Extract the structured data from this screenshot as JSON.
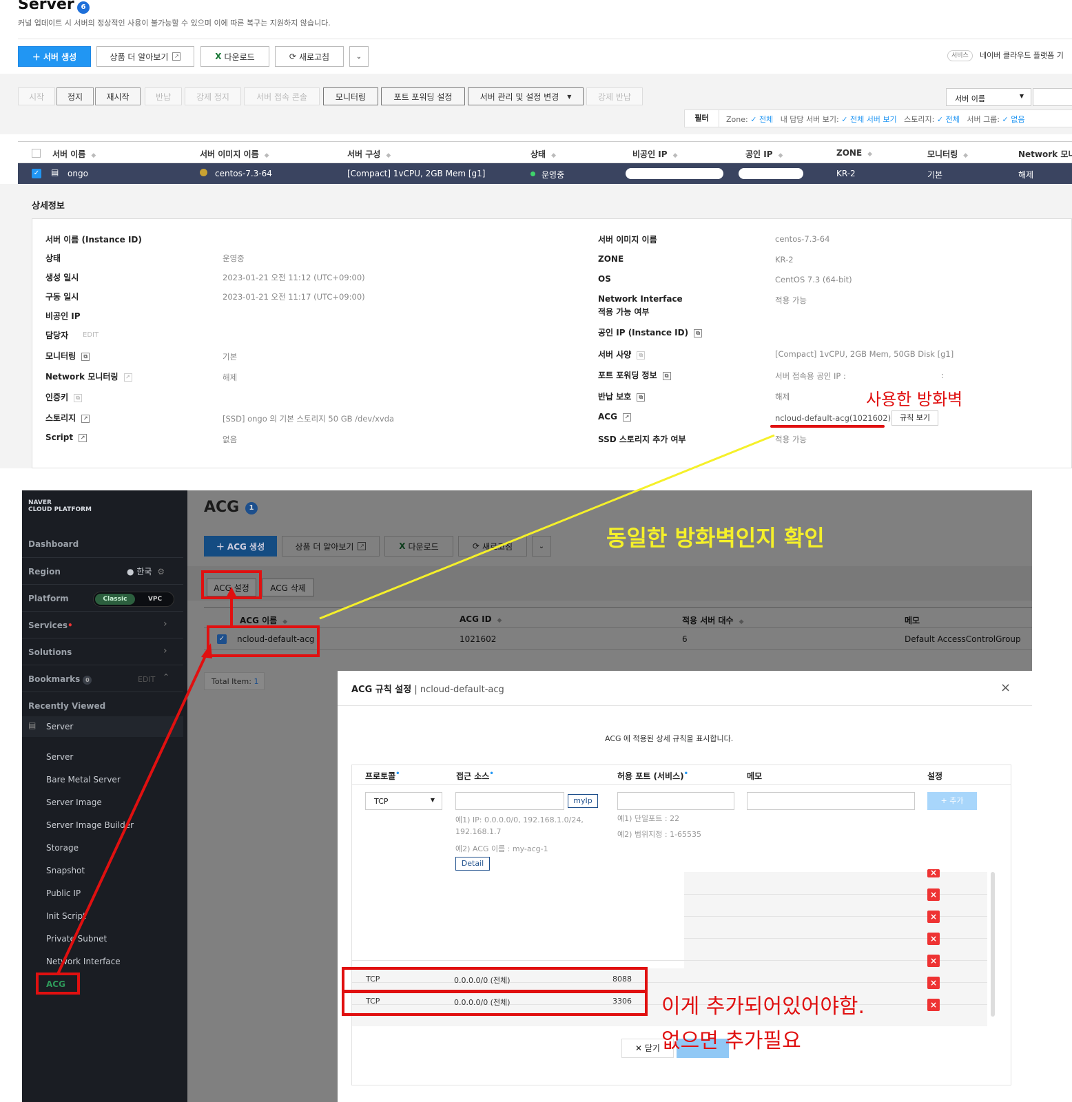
{
  "top": {
    "title": "Server",
    "title_badge": "6",
    "notice": "커널 업데이트 시 서버의 정상적인 사용이 불가능할 수 있으며 이에 따른 복구는 지원하지 않습니다.",
    "toolbar": {
      "create": "서버 생성",
      "learn_more": "상품 더 알아보기",
      "download": "다운로드",
      "refresh": "새로고침"
    },
    "service_tag": "서비스",
    "service_text": "네이버 클라우드 플랫폼 기",
    "actions": [
      "시작",
      "정지",
      "재시작",
      "반납",
      "강제 정지",
      "서버 접속 콘솔",
      "모니터링",
      "포트 포워딩 설정",
      "서버 관리 및 설정 변경",
      "강제 반납"
    ],
    "search_select": "서버 이름",
    "filter": {
      "label": "필터",
      "zone_label": "Zone:",
      "zone_val": "전체",
      "mine_label": "내 담당 서버 보기:",
      "mine_val": "전체 서버 보기",
      "storage_label": "스토리지:",
      "storage_val": "전체",
      "group_label": "서버 그룹:",
      "group_val": "없음"
    },
    "table": {
      "headers": [
        "서버 이름",
        "서버 이미지 이름",
        "서버 구성",
        "상태",
        "비공인 IP",
        "공인 IP",
        "ZONE",
        "모니터링",
        "Network 모니터"
      ],
      "row": {
        "name": "ongo",
        "image": "centos-7.3-64",
        "spec": "[Compact] 1vCPU, 2GB Mem [g1]",
        "status": "운영중",
        "zone": "KR-2",
        "monitoring": "기본",
        "network": "해제"
      }
    },
    "detail": {
      "title": "상세정보",
      "left": [
        {
          "label": "서버 이름 (Instance ID)",
          "value": ""
        },
        {
          "label": "상태",
          "value": "운영중"
        },
        {
          "label": "생성 일시",
          "value": "2023-01-21 오전 11:12 (UTC+09:00)"
        },
        {
          "label": "구동 일시",
          "value": "2023-01-21 오전 11:17 (UTC+09:00)"
        },
        {
          "label": "비공인 IP",
          "value": ""
        },
        {
          "label": "담당자",
          "value": ""
        },
        {
          "label": "모니터링",
          "value": "기본"
        },
        {
          "label": "Network 모니터링",
          "value": "해제"
        },
        {
          "label": "인증키",
          "value": ""
        },
        {
          "label": "스토리지",
          "value": "[SSD] ongo 의 기본 스토리지  50 GB /dev/xvda"
        },
        {
          "label": "Script",
          "value": "없음"
        }
      ],
      "edit": "EDIT",
      "right": [
        {
          "label": "서버 이미지 이름",
          "value": "centos-7.3-64"
        },
        {
          "label": "ZONE",
          "value": "KR-2"
        },
        {
          "label": "OS",
          "value": "CentOS 7.3 (64-bit)"
        },
        {
          "label": "Network Interface",
          "label2": "적용 가능 여부",
          "value": "적용 가능"
        },
        {
          "label": "공인 IP (Instance ID)",
          "value": ""
        },
        {
          "label": "서버 사양",
          "value": "[Compact] 1vCPU, 2GB Mem, 50GB Disk [g1]"
        },
        {
          "label": "포트 포워딩 정보",
          "value": "서버 접속용 공인 IP :"
        },
        {
          "label": "반납 보호",
          "value": "해제"
        },
        {
          "label": "ACG",
          "value": "ncloud-default-acg(1021602)"
        },
        {
          "label": "SSD 스토리지 추가 여부",
          "value": "적용 가능"
        }
      ],
      "rule_view": "규칙 보기",
      "colon": ":"
    }
  },
  "annotations": {
    "firewall_used": "사용한 방화벽",
    "same_firewall": "동일한 방화벽인지 확인",
    "must_be_added": "이게 추가되어있어야함.",
    "add_if_missing": "없으면 추가필요"
  },
  "sidebar": {
    "brand1": "NAVER",
    "brand2": "CLOUD PLATFORM",
    "dashboard": "Dashboard",
    "region": "Region",
    "region_val": "한국",
    "platform": "Platform",
    "classic": "Classic",
    "vpc": "VPC",
    "services": "Services",
    "solutions": "Solutions",
    "bookmarks": "Bookmarks",
    "bookmarks_count": "0",
    "edit": "EDIT",
    "recent": "Recently Viewed",
    "server": "Server",
    "items": [
      "Server",
      "Bare Metal Server",
      "Server Image",
      "Server Image Builder",
      "Storage",
      "Snapshot",
      "Public IP",
      "Init Script",
      "Private Subnet",
      "Network Interface",
      "ACG"
    ]
  },
  "acg": {
    "title": "ACG",
    "badge": "1",
    "create": "ACG 생성",
    "learn_more": "상품 더 알아보기",
    "download": "다운로드",
    "refresh": "새로고침",
    "setting": "ACG 설정",
    "delete": "ACG 삭제",
    "headers": [
      "ACG 이름",
      "ACG ID",
      "적용 서버 대수",
      "메모"
    ],
    "row": {
      "name": "ncloud-default-acg",
      "id": "1021602",
      "count": "6",
      "memo": "Default AccessControlGroup"
    },
    "total_label": "Total Item:",
    "total_val": "1"
  },
  "modal": {
    "title": "ACG 규칙 설정",
    "subtitle": "| ncloud-default-acg",
    "desc": "ACG 에 적용된 상세 규칙을 표시합니다.",
    "headers": [
      "프로토콜",
      "접근 소스",
      "허용 포트 (서비스)",
      "메모",
      "설정"
    ],
    "protocol": "TCP",
    "myip": "myIp",
    "add": "+ 추가",
    "hint_src1": "예1) IP: 0.0.0.0/0, 192.168.1.0/24,",
    "hint_src1b": "192.168.1.7",
    "hint_src2": "예2) ACG 이름 : my-acg-1",
    "detail": "Detail",
    "hint_port1": "예1) 단일포트 : 22",
    "hint_port2": "예2) 범위지정 : 1-65535",
    "rules": [
      {
        "protocol": "TCP",
        "source": "0.0.0.0/0 (전체)",
        "port": "8088"
      },
      {
        "protocol": "TCP",
        "source": "0.0.0.0/0 (전체)",
        "port": "3306"
      }
    ],
    "close": "닫기"
  },
  "colors": {
    "primary": "#2196f3",
    "annotation_red": "#e01010",
    "annotation_yellow": "#f5f02a",
    "sidebar_bg": "#1a1d23",
    "row_selected": "#3a4460"
  }
}
